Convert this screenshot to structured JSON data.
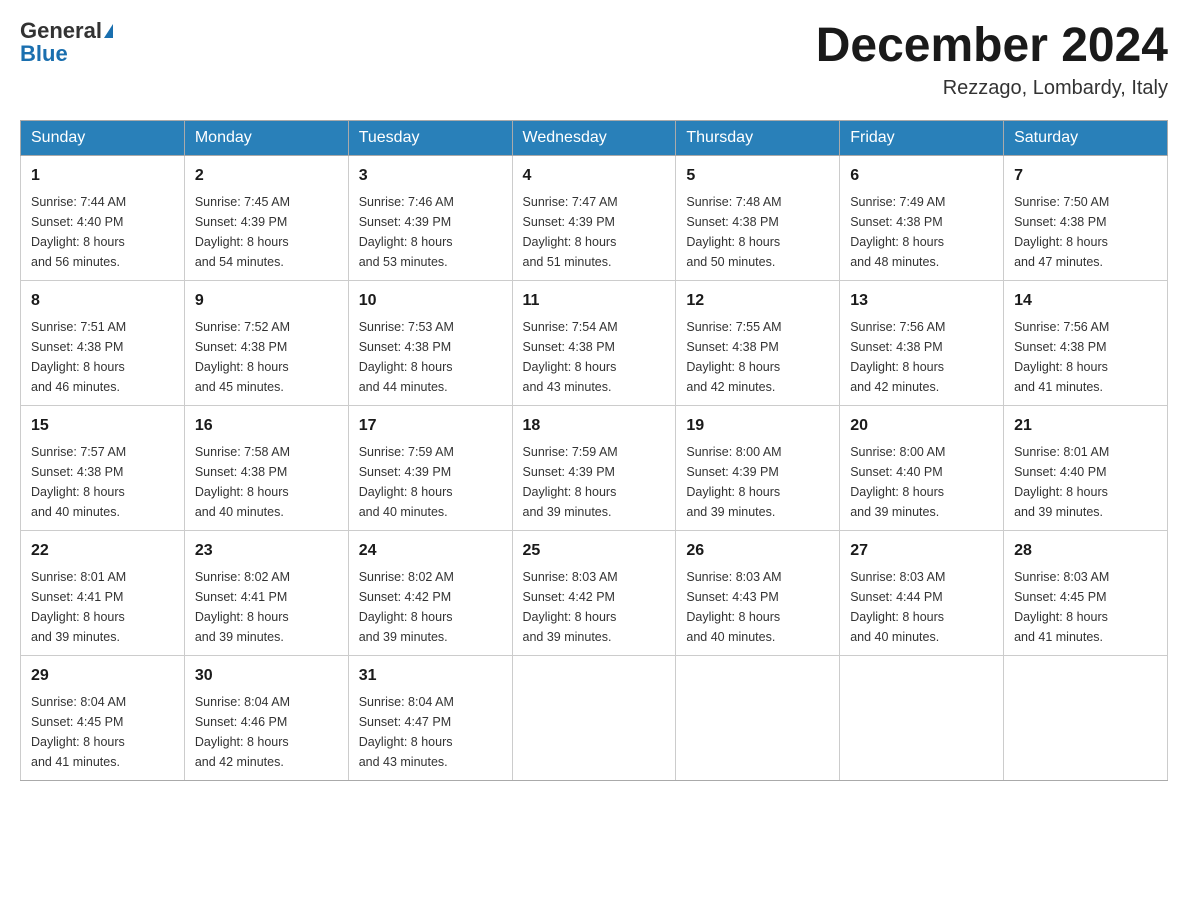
{
  "header": {
    "logo_general": "General",
    "logo_blue": "Blue",
    "month_title": "December 2024",
    "location": "Rezzago, Lombardy, Italy"
  },
  "days_of_week": [
    "Sunday",
    "Monday",
    "Tuesday",
    "Wednesday",
    "Thursday",
    "Friday",
    "Saturday"
  ],
  "weeks": [
    [
      {
        "day": "1",
        "sunrise": "7:44 AM",
        "sunset": "4:40 PM",
        "daylight": "8 hours and 56 minutes."
      },
      {
        "day": "2",
        "sunrise": "7:45 AM",
        "sunset": "4:39 PM",
        "daylight": "8 hours and 54 minutes."
      },
      {
        "day": "3",
        "sunrise": "7:46 AM",
        "sunset": "4:39 PM",
        "daylight": "8 hours and 53 minutes."
      },
      {
        "day": "4",
        "sunrise": "7:47 AM",
        "sunset": "4:39 PM",
        "daylight": "8 hours and 51 minutes."
      },
      {
        "day": "5",
        "sunrise": "7:48 AM",
        "sunset": "4:38 PM",
        "daylight": "8 hours and 50 minutes."
      },
      {
        "day": "6",
        "sunrise": "7:49 AM",
        "sunset": "4:38 PM",
        "daylight": "8 hours and 48 minutes."
      },
      {
        "day": "7",
        "sunrise": "7:50 AM",
        "sunset": "4:38 PM",
        "daylight": "8 hours and 47 minutes."
      }
    ],
    [
      {
        "day": "8",
        "sunrise": "7:51 AM",
        "sunset": "4:38 PM",
        "daylight": "8 hours and 46 minutes."
      },
      {
        "day": "9",
        "sunrise": "7:52 AM",
        "sunset": "4:38 PM",
        "daylight": "8 hours and 45 minutes."
      },
      {
        "day": "10",
        "sunrise": "7:53 AM",
        "sunset": "4:38 PM",
        "daylight": "8 hours and 44 minutes."
      },
      {
        "day": "11",
        "sunrise": "7:54 AM",
        "sunset": "4:38 PM",
        "daylight": "8 hours and 43 minutes."
      },
      {
        "day": "12",
        "sunrise": "7:55 AM",
        "sunset": "4:38 PM",
        "daylight": "8 hours and 42 minutes."
      },
      {
        "day": "13",
        "sunrise": "7:56 AM",
        "sunset": "4:38 PM",
        "daylight": "8 hours and 42 minutes."
      },
      {
        "day": "14",
        "sunrise": "7:56 AM",
        "sunset": "4:38 PM",
        "daylight": "8 hours and 41 minutes."
      }
    ],
    [
      {
        "day": "15",
        "sunrise": "7:57 AM",
        "sunset": "4:38 PM",
        "daylight": "8 hours and 40 minutes."
      },
      {
        "day": "16",
        "sunrise": "7:58 AM",
        "sunset": "4:38 PM",
        "daylight": "8 hours and 40 minutes."
      },
      {
        "day": "17",
        "sunrise": "7:59 AM",
        "sunset": "4:39 PM",
        "daylight": "8 hours and 40 minutes."
      },
      {
        "day": "18",
        "sunrise": "7:59 AM",
        "sunset": "4:39 PM",
        "daylight": "8 hours and 39 minutes."
      },
      {
        "day": "19",
        "sunrise": "8:00 AM",
        "sunset": "4:39 PM",
        "daylight": "8 hours and 39 minutes."
      },
      {
        "day": "20",
        "sunrise": "8:00 AM",
        "sunset": "4:40 PM",
        "daylight": "8 hours and 39 minutes."
      },
      {
        "day": "21",
        "sunrise": "8:01 AM",
        "sunset": "4:40 PM",
        "daylight": "8 hours and 39 minutes."
      }
    ],
    [
      {
        "day": "22",
        "sunrise": "8:01 AM",
        "sunset": "4:41 PM",
        "daylight": "8 hours and 39 minutes."
      },
      {
        "day": "23",
        "sunrise": "8:02 AM",
        "sunset": "4:41 PM",
        "daylight": "8 hours and 39 minutes."
      },
      {
        "day": "24",
        "sunrise": "8:02 AM",
        "sunset": "4:42 PM",
        "daylight": "8 hours and 39 minutes."
      },
      {
        "day": "25",
        "sunrise": "8:03 AM",
        "sunset": "4:42 PM",
        "daylight": "8 hours and 39 minutes."
      },
      {
        "day": "26",
        "sunrise": "8:03 AM",
        "sunset": "4:43 PM",
        "daylight": "8 hours and 40 minutes."
      },
      {
        "day": "27",
        "sunrise": "8:03 AM",
        "sunset": "4:44 PM",
        "daylight": "8 hours and 40 minutes."
      },
      {
        "day": "28",
        "sunrise": "8:03 AM",
        "sunset": "4:45 PM",
        "daylight": "8 hours and 41 minutes."
      }
    ],
    [
      {
        "day": "29",
        "sunrise": "8:04 AM",
        "sunset": "4:45 PM",
        "daylight": "8 hours and 41 minutes."
      },
      {
        "day": "30",
        "sunrise": "8:04 AM",
        "sunset": "4:46 PM",
        "daylight": "8 hours and 42 minutes."
      },
      {
        "day": "31",
        "sunrise": "8:04 AM",
        "sunset": "4:47 PM",
        "daylight": "8 hours and 43 minutes."
      },
      null,
      null,
      null,
      null
    ]
  ],
  "labels": {
    "sunrise": "Sunrise:",
    "sunset": "Sunset:",
    "daylight": "Daylight:"
  }
}
